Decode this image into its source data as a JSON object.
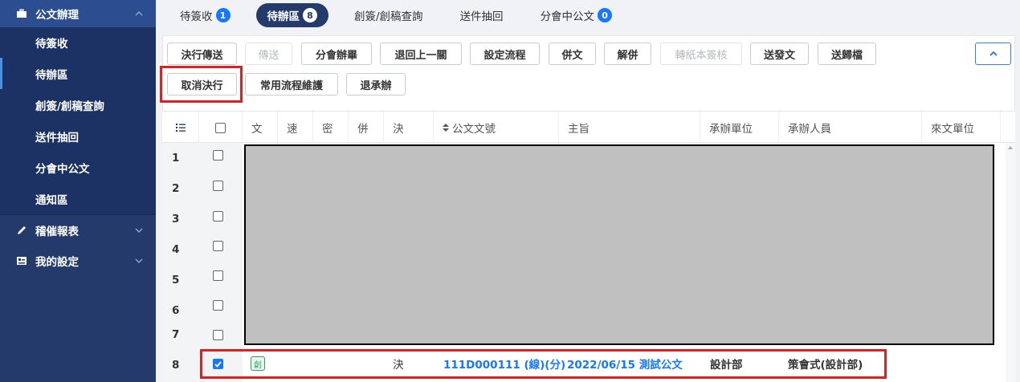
{
  "sidebar": {
    "section_docs": "公文辦理",
    "items": [
      "待簽收",
      "待辦區",
      "創簽/創稿查詢",
      "送件抽回",
      "分會中公文",
      "通知區"
    ],
    "section_reports": "稽催報表",
    "section_settings": "我的設定"
  },
  "tabs": [
    {
      "label": "待簽收",
      "count": "1"
    },
    {
      "label": "待辦區",
      "count": "8"
    },
    {
      "label": "創簽/創稿查詢",
      "count": ""
    },
    {
      "label": "送件抽回",
      "count": ""
    },
    {
      "label": "分會中公文",
      "count": "0"
    }
  ],
  "toolbar": {
    "row1": [
      "決行傳送",
      "傳送",
      "分會辦畢",
      "退回上一關",
      "設定流程",
      "併文",
      "解併",
      "轉紙本簽核",
      "送發文",
      "送歸檔"
    ],
    "row2": [
      "取消決行",
      "常用流程維護",
      "退承辦"
    ]
  },
  "table": {
    "headers": [
      "文",
      "速",
      "密",
      "併",
      "決",
      "公文文號",
      "主旨",
      "承辦單位",
      "承辦人員",
      "來文單位"
    ],
    "row_numbers": [
      "1",
      "2",
      "3",
      "4",
      "5",
      "6",
      "7",
      "8"
    ],
    "row8": {
      "type_badge": "創",
      "decision": "決",
      "doc_number": "111D000111 (線)(分)",
      "subject": "2022/06/15 測試公文",
      "unit": "設計部",
      "staff": "策會式(設計部)"
    }
  },
  "colors": {
    "sidebar_bg": "#243a6b",
    "accent": "#1677ff",
    "highlight": "#e02020"
  }
}
